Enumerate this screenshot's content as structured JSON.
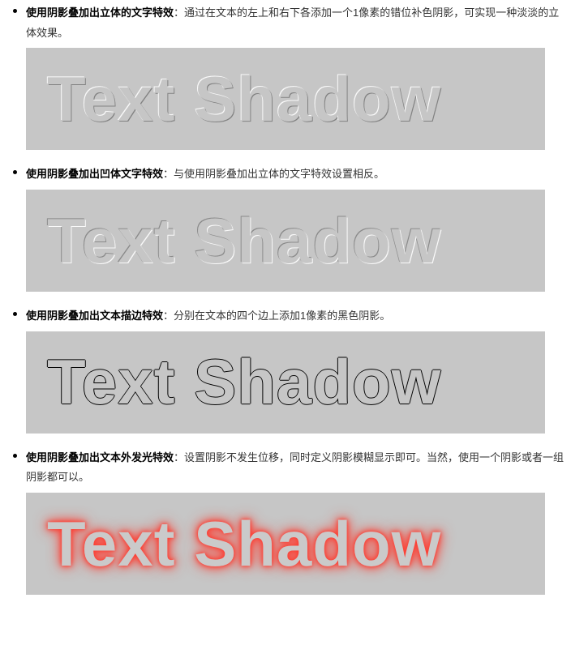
{
  "items": [
    {
      "title": "使用阴影叠加出立体的文字特效",
      "desc": "：通过在文本的左上和右下各添加一个1像素的错位补色阴影，可实现一种淡淡的立体效果。",
      "sample": "Text Shadow"
    },
    {
      "title": "使用阴影叠加出凹体文字特效",
      "desc": "：与使用阴影叠加出立体的文字特效设置相反。",
      "sample": "Text Shadow"
    },
    {
      "title": "使用阴影叠加出文本描边特效",
      "desc": "：分别在文本的四个边上添加1像素的黑色阴影。",
      "sample": "Text Shadow"
    },
    {
      "title": "使用阴影叠加出文本外发光特效",
      "desc": "：设置阴影不发生位移，同时定义阴影模糊显示即可。当然，使用一个阴影或者一组阴影都可以。",
      "sample": "Text Shadow"
    }
  ]
}
